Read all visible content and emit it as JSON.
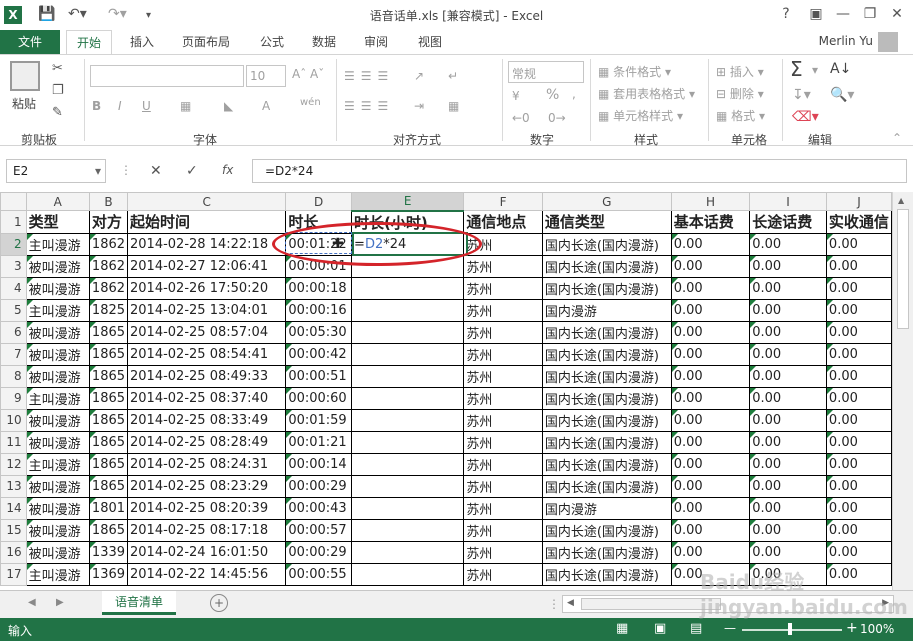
{
  "window": {
    "title": "语音话单.xls  [兼容模式] - Excel",
    "help": "?"
  },
  "tabs": [
    "开始",
    "插入",
    "页面布局",
    "公式",
    "数据",
    "审阅",
    "视图"
  ],
  "file_tab": "文件",
  "user": "Merlin Yu",
  "ribbon": {
    "clipboard": {
      "name": "剪贴板",
      "paste": "粘贴"
    },
    "font": {
      "name": "字体",
      "size": "10",
      "bold": "B",
      "italic": "I",
      "underline": "U",
      "phonetic": "wén"
    },
    "alignment": {
      "name": "对齐方式"
    },
    "number": {
      "name": "数字",
      "format": "常规",
      "percent": "%"
    },
    "styles": {
      "name": "样式",
      "cond": "条件格式",
      "table": "套用表格格式",
      "cell": "单元格样式"
    },
    "cells": {
      "name": "单元格",
      "insert": "插入",
      "delete": "删除",
      "format": "格式"
    },
    "editing": {
      "name": "编辑"
    }
  },
  "formula_bar": {
    "name_box": "E2",
    "fx": "fx",
    "formula": "=D2*24"
  },
  "columns": [
    "A",
    "B",
    "C",
    "D",
    "E",
    "F",
    "G",
    "H",
    "I",
    "J"
  ],
  "header_row": [
    "类型",
    "对方",
    "起始时间",
    "时长",
    "时长(小时)",
    "通信地点",
    "通信类型",
    "基本话费",
    "长途话费",
    "实收通信"
  ],
  "rows": [
    [
      "2",
      "主叫漫游",
      "1862",
      "2014-02-28  14:22:18",
      "00:01:22",
      "=D2*24",
      "苏州",
      "国内长途(国内漫游)",
      "0.00",
      "0.00",
      "0.00"
    ],
    [
      "3",
      "被叫漫游",
      "1862",
      "2014-02-27  12:06:41",
      "00:00:01",
      "",
      "苏州",
      "国内长途(国内漫游)",
      "0.00",
      "0.00",
      "0.00"
    ],
    [
      "4",
      "被叫漫游",
      "1862",
      "2014-02-26  17:50:20",
      "00:00:18",
      "",
      "苏州",
      "国内长途(国内漫游)",
      "0.00",
      "0.00",
      "0.00"
    ],
    [
      "5",
      "主叫漫游",
      "1825",
      "2014-02-25  13:04:01",
      "00:00:16",
      "",
      "苏州",
      "国内漫游",
      "0.00",
      "0.00",
      "0.00"
    ],
    [
      "6",
      "被叫漫游",
      "1865",
      "2014-02-25  08:57:04",
      "00:05:30",
      "",
      "苏州",
      "国内长途(国内漫游)",
      "0.00",
      "0.00",
      "0.00"
    ],
    [
      "7",
      "被叫漫游",
      "1865",
      "2014-02-25  08:54:41",
      "00:00:42",
      "",
      "苏州",
      "国内长途(国内漫游)",
      "0.00",
      "0.00",
      "0.00"
    ],
    [
      "8",
      "被叫漫游",
      "1865",
      "2014-02-25  08:49:33",
      "00:00:51",
      "",
      "苏州",
      "国内长途(国内漫游)",
      "0.00",
      "0.00",
      "0.00"
    ],
    [
      "9",
      "主叫漫游",
      "1865",
      "2014-02-25  08:37:40",
      "00:00:60",
      "",
      "苏州",
      "国内长途(国内漫游)",
      "0.00",
      "0.00",
      "0.00"
    ],
    [
      "10",
      "被叫漫游",
      "1865",
      "2014-02-25  08:33:49",
      "00:01:59",
      "",
      "苏州",
      "国内长途(国内漫游)",
      "0.00",
      "0.00",
      "0.00"
    ],
    [
      "11",
      "被叫漫游",
      "1865",
      "2014-02-25  08:28:49",
      "00:01:21",
      "",
      "苏州",
      "国内长途(国内漫游)",
      "0.00",
      "0.00",
      "0.00"
    ],
    [
      "12",
      "主叫漫游",
      "1865",
      "2014-02-25  08:24:31",
      "00:00:14",
      "",
      "苏州",
      "国内长途(国内漫游)",
      "0.00",
      "0.00",
      "0.00"
    ],
    [
      "13",
      "被叫漫游",
      "1865",
      "2014-02-25  08:23:29",
      "00:00:29",
      "",
      "苏州",
      "国内长途(国内漫游)",
      "0.00",
      "0.00",
      "0.00"
    ],
    [
      "14",
      "被叫漫游",
      "1801",
      "2014-02-25  08:20:39",
      "00:00:43",
      "",
      "苏州",
      "国内漫游",
      "0.00",
      "0.00",
      "0.00"
    ],
    [
      "15",
      "被叫漫游",
      "1865",
      "2014-02-25  08:17:18",
      "00:00:57",
      "",
      "苏州",
      "国内长途(国内漫游)",
      "0.00",
      "0.00",
      "0.00"
    ],
    [
      "16",
      "被叫漫游",
      "1339",
      "2014-02-24  16:01:50",
      "00:00:29",
      "",
      "苏州",
      "国内长途(国内漫游)",
      "0.00",
      "0.00",
      "0.00"
    ],
    [
      "17",
      "主叫漫游",
      "1369",
      "2014-02-22  14:45:56",
      "00:00:55",
      "",
      "苏州",
      "国内长途(国内漫游)",
      "0.00",
      "0.00",
      "0.00"
    ]
  ],
  "sheet_tab": "语音清单",
  "status": {
    "mode": "输入",
    "zoom": "100%"
  },
  "watermark": "Baidu经验 jingyan.baidu.com"
}
